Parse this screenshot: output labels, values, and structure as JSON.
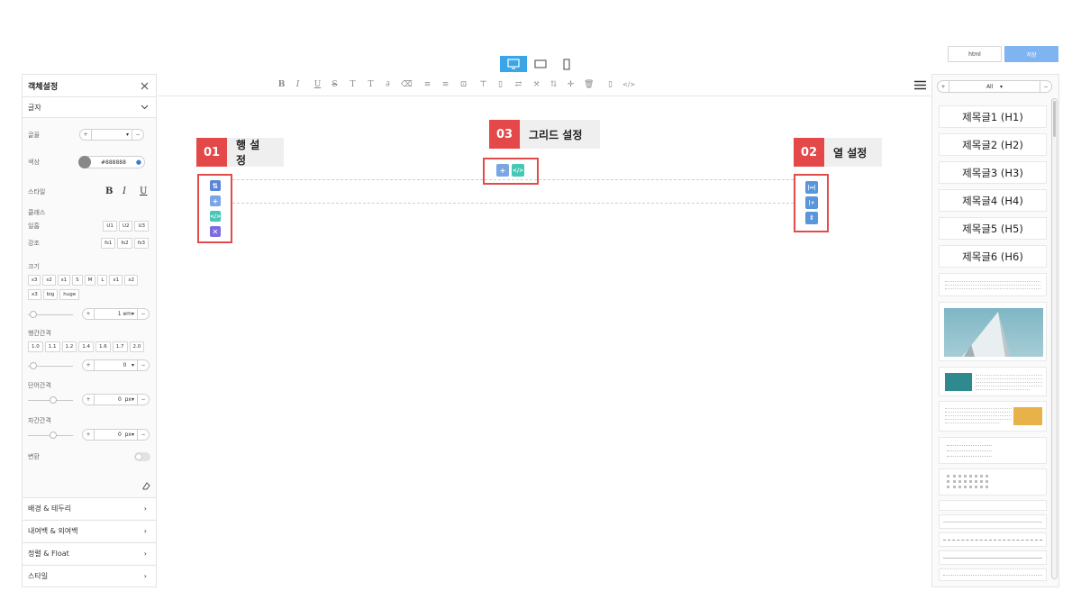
{
  "top": {
    "html_button_label": "html",
    "save_button_label": "저장",
    "devices": [
      "desktop-icon",
      "tablet-icon",
      "mobile-icon"
    ],
    "active_device": "desktop",
    "accent_color": "#3aa6e8"
  },
  "left_panel": {
    "title": "객체설정",
    "section": "글자",
    "font_label": "글꼴",
    "color_label": "색상",
    "color_value": "#888888",
    "style_label": "스타일",
    "style_buttons": [
      "B",
      "I",
      "U"
    ],
    "class_label": "클래스",
    "heading_label": "일홉",
    "heading_options": [
      "U1",
      "U2",
      "U3"
    ],
    "emphasis_label": "강조",
    "emphasis_options": [
      "fs1",
      "fs2",
      "fs3"
    ],
    "size_label": "크기",
    "size_options_row1": [
      "s3",
      "s2",
      "s1",
      "S",
      "M",
      "L",
      "x1",
      "x2"
    ],
    "size_options_row2": [
      "x3",
      "big",
      "huge"
    ],
    "size_value": "1",
    "size_unit": "em",
    "line_height_label": "행간간격",
    "line_height_options": [
      "1.0",
      "1.1",
      "1.2",
      "1.4",
      "1.6",
      "1.7",
      "2.0"
    ],
    "line_height_value": "0",
    "word_spacing_label": "단어간격",
    "word_spacing_value": "0",
    "word_spacing_unit": "px",
    "letter_spacing_label": "자간간격",
    "letter_spacing_value": "0",
    "letter_spacing_unit": "px",
    "transform_label": "변환",
    "sections": [
      "배경 & 테두리",
      "내여백 & 외여백",
      "정렬 & Float",
      "스타일"
    ]
  },
  "callouts": {
    "row": {
      "num": "01",
      "label": "행 설정"
    },
    "grid": {
      "num": "03",
      "label": "그리드 설정"
    },
    "col": {
      "num": "02",
      "label": "열 설정"
    }
  },
  "right_panel": {
    "filter_value": "All",
    "headings": [
      "제목글1 (H1)",
      "제목글2 (H2)",
      "제목글3 (H3)",
      "제목글4 (H4)",
      "제목글5 (H5)",
      "제목글6 (H6)"
    ]
  }
}
